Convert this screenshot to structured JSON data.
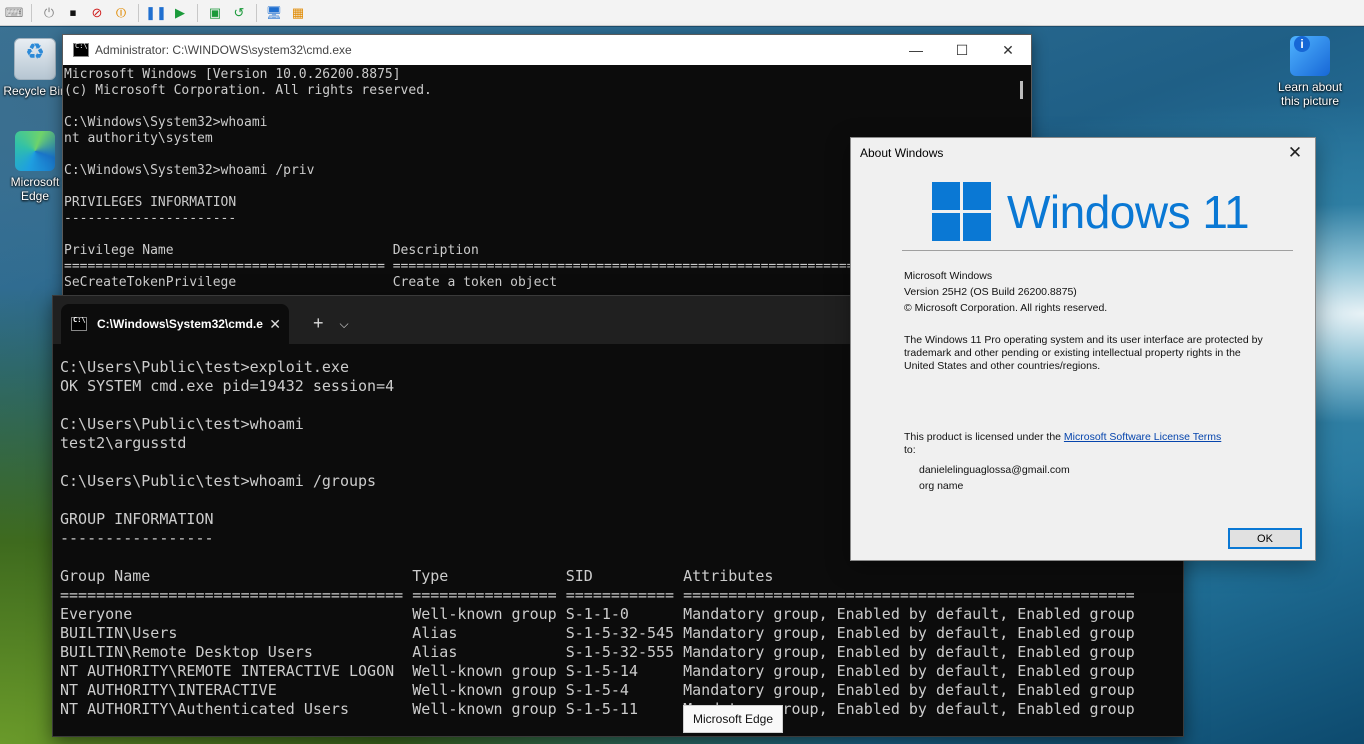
{
  "desktop": {
    "icons": {
      "recycle_bin": "Recycle Bin",
      "edge": "Microsoft Edge",
      "learn": "Learn about this picture"
    }
  },
  "toolbar": {
    "icons": [
      "ctrl-alt-del-icon",
      "start-icon",
      "turn-off-icon",
      "shutdown-icon",
      "power-icon",
      "pause-icon",
      "resume-icon",
      "checkpoint-icon",
      "revert-icon",
      "enhanced-session-icon",
      "share-icon"
    ]
  },
  "admin_cmd": {
    "title": "Administrator: C:\\WINDOWS\\system32\\cmd.exe",
    "lines": [
      "Microsoft Windows [Version 10.0.26200.8875]",
      "(c) Microsoft Corporation. All rights reserved.",
      "",
      "C:\\Windows\\System32>whoami",
      "nt authority\\system",
      "",
      "C:\\Windows\\System32>whoami /priv",
      "",
      "PRIVILEGES INFORMATION",
      "----------------------",
      "",
      "Privilege Name                            Description",
      "========================================= ==================================================================",
      "SeCreateTokenPrivilege                    Create a token object"
    ]
  },
  "terminal": {
    "tab_title": "C:\\Windows\\System32\\cmd.e",
    "lines": [
      "C:\\Users\\Public\\test>exploit.exe",
      "OK SYSTEM cmd.exe pid=19432 session=4",
      "",
      "C:\\Users\\Public\\test>whoami",
      "test2\\argusstd",
      "",
      "C:\\Users\\Public\\test>whoami /groups",
      "",
      "GROUP INFORMATION",
      "-----------------",
      "",
      "Group Name                             Type             SID          Attributes",
      "====================================== ================ ============ ==================================================",
      "Everyone                               Well-known group S-1-1-0      Mandatory group, Enabled by default, Enabled group",
      "BUILTIN\\Users                          Alias            S-1-5-32-545 Mandatory group, Enabled by default, Enabled group",
      "BUILTIN\\Remote Desktop Users           Alias            S-1-5-32-555 Mandatory group, Enabled by default, Enabled group",
      "NT AUTHORITY\\REMOTE INTERACTIVE LOGON  Well-known group S-1-5-14     Mandatory group, Enabled by default, Enabled group",
      "NT AUTHORITY\\INTERACTIVE               Well-known group S-1-5-4      Mandatory group, Enabled by default, Enabled group",
      "NT AUTHORITY\\Authenticated Users       Well-known group S-1-5-11     Mandatory group, Enabled by default, Enabled group"
    ]
  },
  "about": {
    "title": "About Windows",
    "logo_text": "Windows 11",
    "product": "Microsoft Windows",
    "version": "Version 25H2 (OS Build 26200.8875)",
    "copyright": "© Microsoft Corporation. All rights reserved.",
    "legal": "The Windows 11 Pro operating system and its user interface are protected by trademark and other pending or existing intellectual property rights in the United States and other countries/regions.",
    "license_prefix": "This product is licensed under the ",
    "license_link": "Microsoft Software License Terms",
    "license_suffix": " to:",
    "licensee_email": "danielelinguaglossa@gmail.com",
    "licensee_org": "org name",
    "ok": "OK"
  },
  "tooltip": "Microsoft Edge",
  "colors": {
    "accent": "#0a78d4",
    "console_bg": "#0c0c0c",
    "console_fg": "#cccccc"
  }
}
